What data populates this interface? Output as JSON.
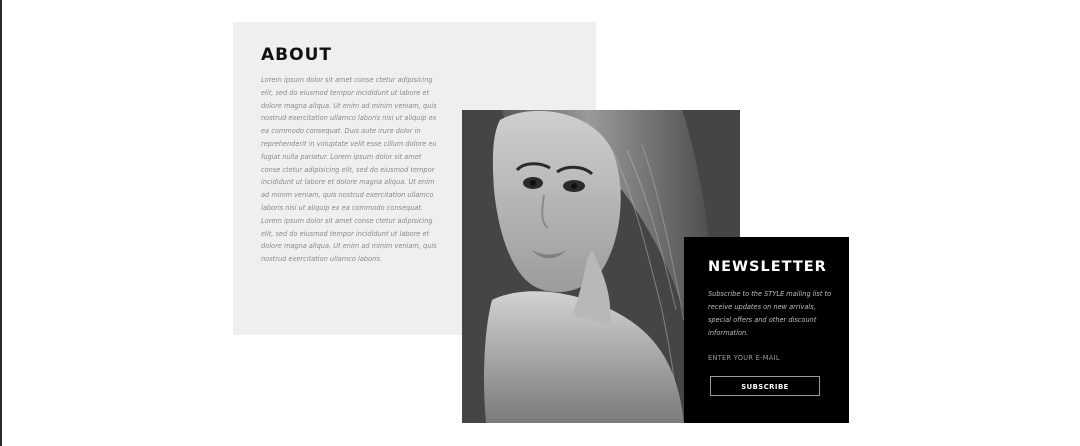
{
  "about": {
    "title": "ABOUT",
    "body": "Lorem ipsum dolor sit amet conse ctetur adipisicing elit, sed do eiusmod tempor incididunt ut labore et dolore magna aliqua. Ut enim ad minim veniam, quis nostrud exercitation ullamco laboris nisi ut aliquip ex ea commodo consequat. Duis aute irure dolor in reprehenderit in voluptate velit esse cillum dolore eu fugiat nulla pariatur. Lorem ipsum dolor sit amet conse ctetur adipisicing elit, sed do eiusmod tempor incididunt ut labore et dolore magna aliqua. Ut enim ad minim veniam, quis nostrud exercitation ullamco laboris nisi ut aliquip ex ea commodo consequat.  Lorem ipsum dolor sit amet conse ctetur adipisicing elit, sed do eiusmod tempor incididunt ut labore et dolore magna aliqua. Ut enim ad minim veniam, quis nostrud exercitation ullamco laboris."
  },
  "newsletter": {
    "title": "NEWSLETTER",
    "description": "Subscribe to the STYLE mailing list to receive updates on new arrivals, special offers and other discount information.",
    "email_placeholder": "ENTER YOUR E-MAIL",
    "subscribe_label": "SUBSCRIBE"
  },
  "colors": {
    "about_background": "#efefef",
    "newsletter_background": "#000000",
    "page_background": "#ffffff"
  }
}
